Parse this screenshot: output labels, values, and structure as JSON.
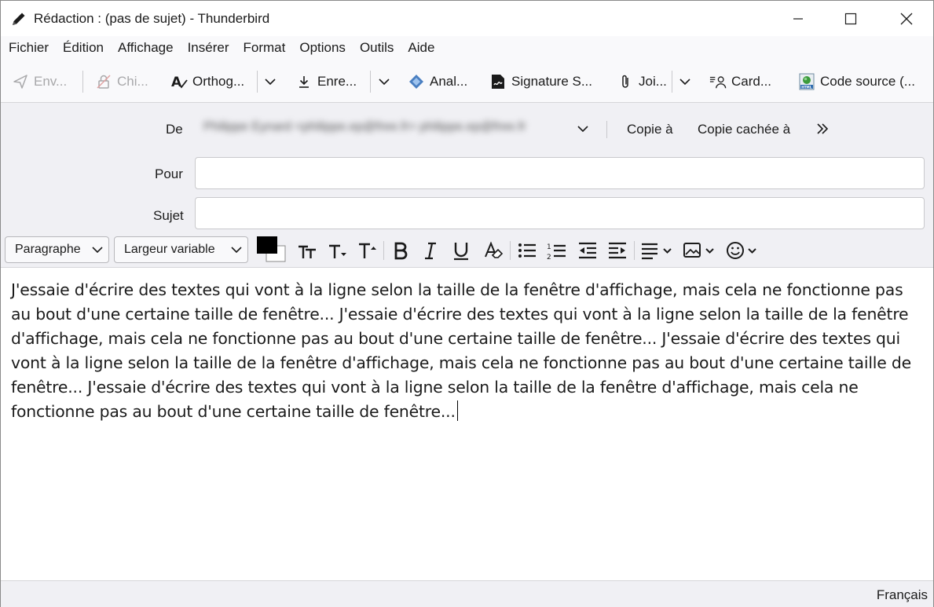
{
  "window": {
    "title": "Rédaction : (pas de sujet) - Thunderbird"
  },
  "menu": {
    "items": [
      "Fichier",
      "Édition",
      "Affichage",
      "Insérer",
      "Format",
      "Options",
      "Outils",
      "Aide"
    ]
  },
  "toolbar": {
    "send_label": "Env...",
    "encrypt_label": "Chi...",
    "spelling_label": "Orthog...",
    "save_label": "Enre...",
    "analyze_label": "Anal...",
    "signature_label": "Signature S...",
    "attach_label": "Joi...",
    "card_label": "Card...",
    "source_label": "Code source (..."
  },
  "headers": {
    "from_label": "De",
    "from_value": "Philippe Eynard <philippe.ep@free.fr> philippe.ep@free.fr",
    "cc_label": "Copie à",
    "bcc_label": "Copie cachée à",
    "to_label": "Pour",
    "to_value": "",
    "subject_label": "Sujet",
    "subject_value": ""
  },
  "format": {
    "paragraph_select": "Paragraphe",
    "font_select": "Largeur variable",
    "text_color": "#000000",
    "bg_color": "#ffffff"
  },
  "body": {
    "text": "J'essaie d'écrire des textes qui vont à la ligne selon la taille de la fenêtre d'affichage, mais cela ne fonctionne pas au bout d'une certaine taille de fenêtre... J'essaie d'écrire des textes qui vont à la ligne selon la taille de la fenêtre d'affichage, mais cela ne fonctionne pas au bout d'une certaine taille de fenêtre... J'essaie d'écrire des textes qui vont à la ligne selon la taille de la fenêtre d'affichage, mais cela ne fonctionne pas au bout d'une certaine taille de fenêtre... J'essaie d'écrire des textes qui vont à la ligne selon la taille de la fenêtre d'affichage, mais cela ne fonctionne pas au bout d'une certaine taille de fenêtre..."
  },
  "status": {
    "language": "Français"
  }
}
